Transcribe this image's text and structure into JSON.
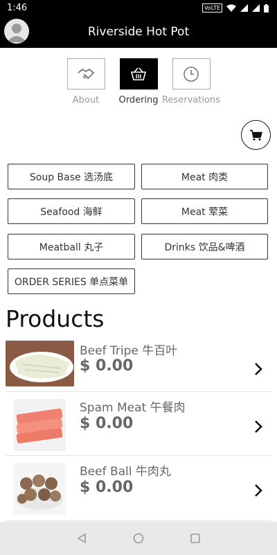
{
  "status_bar": {
    "time": "1:46",
    "network_badge": "VoLTE"
  },
  "header": {
    "title": "Riverside Hot Pot",
    "avatar_icon": "user-avatar-icon"
  },
  "nav_tabs": [
    {
      "label": "About",
      "icon": "handshake-icon",
      "active": false
    },
    {
      "label": "Ordering",
      "icon": "basket-icon",
      "active": true
    },
    {
      "label": "Reservations",
      "icon": "clock-icon",
      "active": false
    }
  ],
  "cart": {
    "icon": "cart-icon"
  },
  "categories": [
    "Soup Base 选汤底",
    "Meat 肉类",
    "Seafood 海鲜",
    "Meat 荤菜",
    "Meatball 丸子",
    "Drinks 饮品&啤酒",
    "ORDER SERIES 单点菜单"
  ],
  "products_heading": "Products",
  "products": [
    {
      "name": "Beef Tripe 牛百叶",
      "price": "$ 0.00"
    },
    {
      "name": "Spam Meat 午餐肉",
      "price": "$ 0.00"
    },
    {
      "name": "Beef Ball 牛肉丸",
      "price": "$ 0.00"
    }
  ],
  "colors": {
    "header_bg": "#000000",
    "border": "#333333",
    "muted_text": "#999999"
  }
}
